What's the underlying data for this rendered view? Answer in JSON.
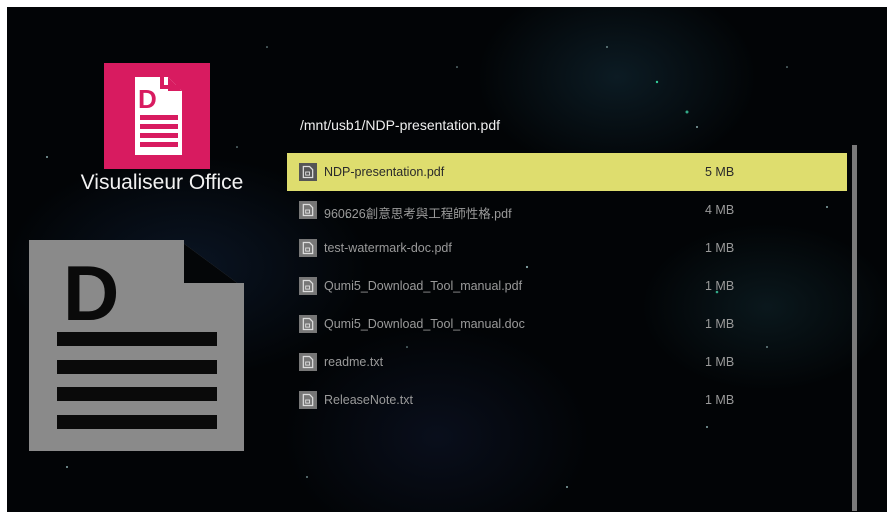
{
  "app": {
    "title": "Visualiseur Office",
    "logo_letter": "D",
    "logo_color": "#d81b60"
  },
  "path": "/mnt/usb1/NDP-presentation.pdf",
  "selected_row_color": "#dedd6e",
  "files": [
    {
      "name": "NDP-presentation.pdf",
      "size": "5 MB",
      "selected": true
    },
    {
      "name": "960626創意思考與工程師性格.pdf",
      "size": "4 MB",
      "selected": false
    },
    {
      "name": "test-watermark-doc.pdf",
      "size": "1 MB",
      "selected": false
    },
    {
      "name": "Qumi5_Download_Tool_manual.pdf",
      "size": "1 MB",
      "selected": false
    },
    {
      "name": "Qumi5_Download_Tool_manual.doc",
      "size": "1 MB",
      "selected": false
    },
    {
      "name": "readme.txt",
      "size": "1 MB",
      "selected": false
    },
    {
      "name": "ReleaseNote.txt",
      "size": "1 MB",
      "selected": false
    }
  ],
  "icons": {
    "app_logo": "document-d-icon",
    "big_preview": "document-d-icon",
    "file_row": "file-icon"
  }
}
